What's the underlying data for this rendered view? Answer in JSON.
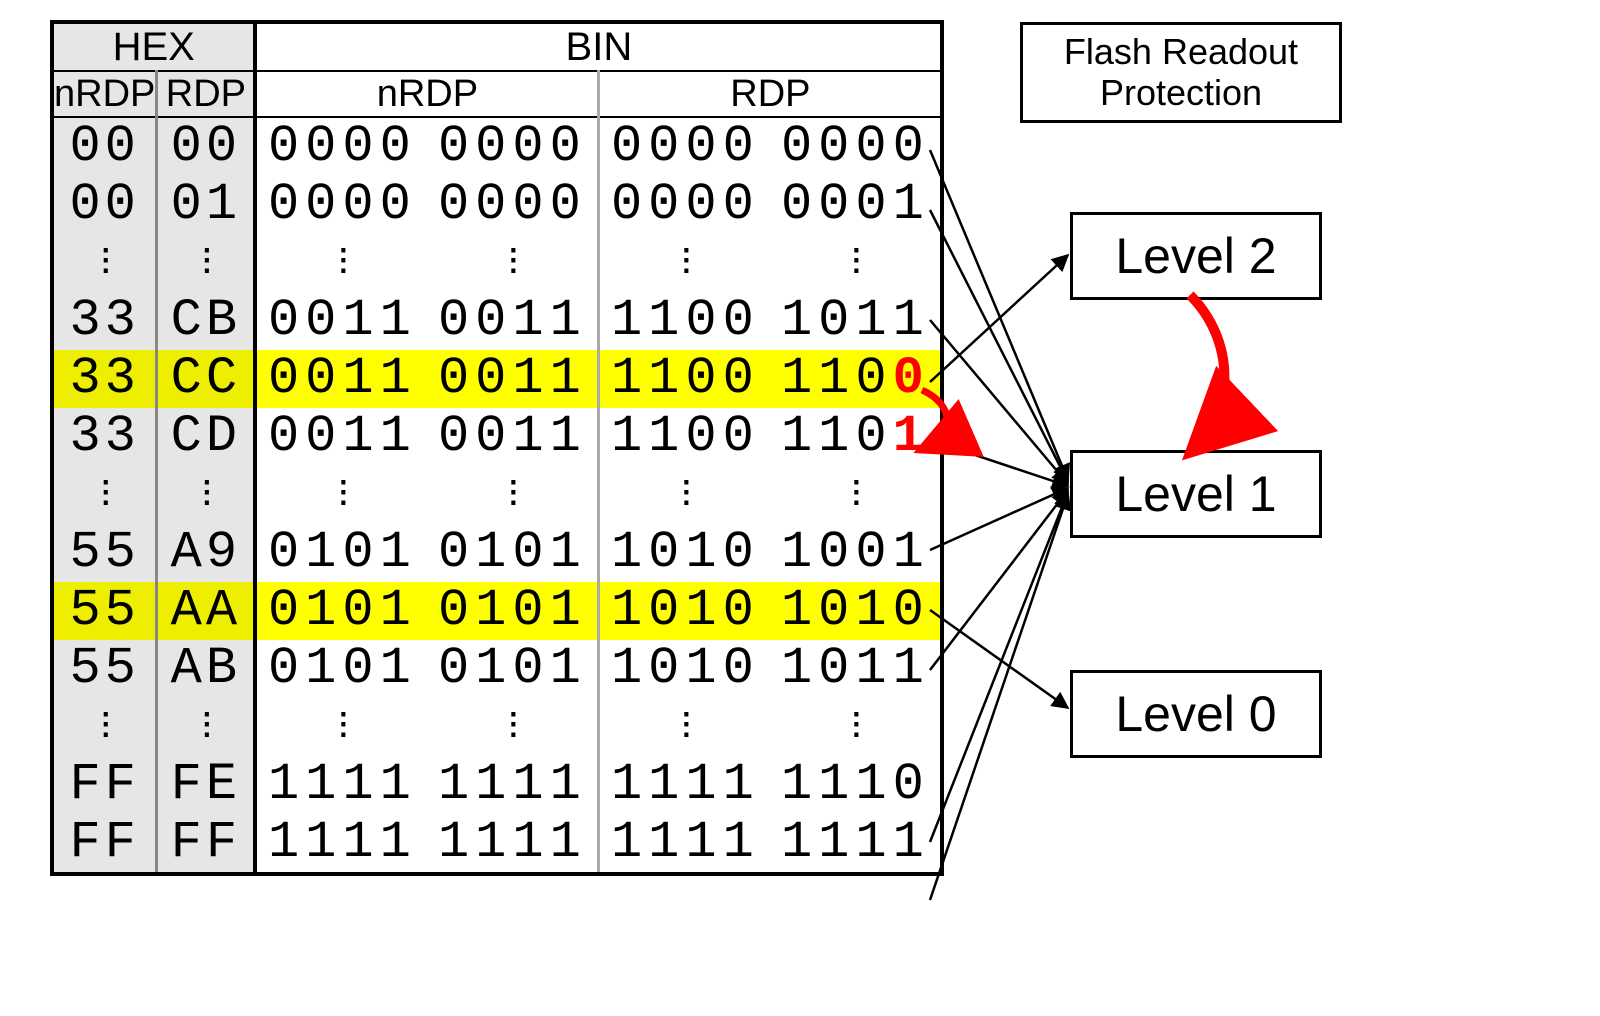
{
  "headers": {
    "hex": "HEX",
    "bin": "BIN",
    "nrdp": "nRDP",
    "rdp": "RDP"
  },
  "title": "Flash Readout Protection",
  "levels": {
    "l2": "Level 2",
    "l1": "Level 1",
    "l0": "Level 0"
  },
  "rows": [
    {
      "hex_nrdp": "00",
      "hex_rdp": "00",
      "bin_nrdp_a": "0000",
      "bin_nrdp_b": "0000",
      "bin_rdp_a": "0000",
      "bin_rdp_b": "0000",
      "hl": false,
      "dots": false,
      "red_last": ""
    },
    {
      "hex_nrdp": "00",
      "hex_rdp": "01",
      "bin_nrdp_a": "0000",
      "bin_nrdp_b": "0000",
      "bin_rdp_a": "0000",
      "bin_rdp_b": "0001",
      "hl": false,
      "dots": false,
      "red_last": ""
    },
    {
      "dots": true
    },
    {
      "hex_nrdp": "33",
      "hex_rdp": "CB",
      "bin_nrdp_a": "0011",
      "bin_nrdp_b": "0011",
      "bin_rdp_a": "1100",
      "bin_rdp_b": "1011",
      "hl": false,
      "dots": false,
      "red_last": ""
    },
    {
      "hex_nrdp": "33",
      "hex_rdp": "CC",
      "bin_nrdp_a": "0011",
      "bin_nrdp_b": "0011",
      "bin_rdp_a": "1100",
      "bin_rdp_b": "110",
      "hl": true,
      "dots": false,
      "red_last": "0"
    },
    {
      "hex_nrdp": "33",
      "hex_rdp": "CD",
      "bin_nrdp_a": "0011",
      "bin_nrdp_b": "0011",
      "bin_rdp_a": "1100",
      "bin_rdp_b": "110",
      "hl": false,
      "dots": false,
      "red_last": "1"
    },
    {
      "dots": true
    },
    {
      "hex_nrdp": "55",
      "hex_rdp": "A9",
      "bin_nrdp_a": "0101",
      "bin_nrdp_b": "0101",
      "bin_rdp_a": "1010",
      "bin_rdp_b": "1001",
      "hl": false,
      "dots": false,
      "red_last": ""
    },
    {
      "hex_nrdp": "55",
      "hex_rdp": "AA",
      "bin_nrdp_a": "0101",
      "bin_nrdp_b": "0101",
      "bin_rdp_a": "1010",
      "bin_rdp_b": "1010",
      "hl": true,
      "dots": false,
      "red_last": ""
    },
    {
      "hex_nrdp": "55",
      "hex_rdp": "AB",
      "bin_nrdp_a": "0101",
      "bin_nrdp_b": "0101",
      "bin_rdp_a": "1010",
      "bin_rdp_b": "1011",
      "hl": false,
      "dots": false,
      "red_last": ""
    },
    {
      "dots": true
    },
    {
      "hex_nrdp": "FF",
      "hex_rdp": "FE",
      "bin_nrdp_a": "1111",
      "bin_nrdp_b": "1111",
      "bin_rdp_a": "1111",
      "bin_rdp_b": "1110",
      "hl": false,
      "dots": false,
      "red_last": ""
    },
    {
      "hex_nrdp": "FF",
      "hex_rdp": "FF",
      "bin_nrdp_a": "1111",
      "bin_nrdp_b": "1111",
      "bin_rdp_a": "1111",
      "bin_rdp_b": "1111",
      "hl": false,
      "dots": false,
      "red_last": ""
    }
  ]
}
